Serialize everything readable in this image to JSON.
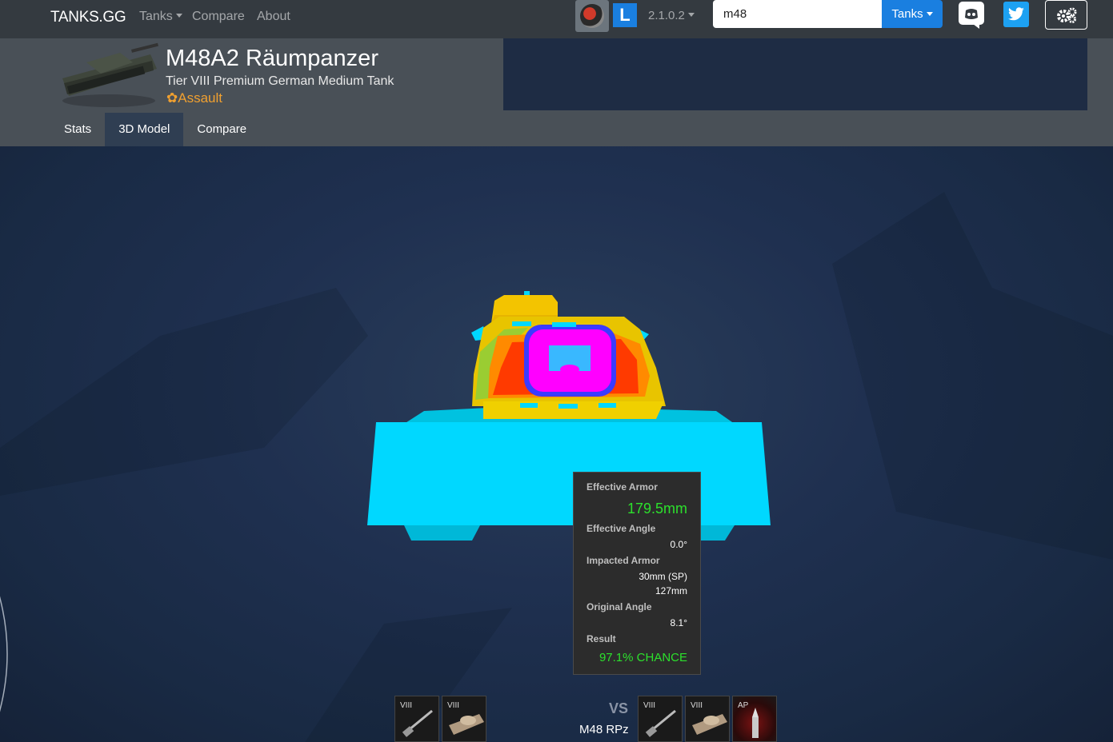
{
  "navbar": {
    "brand": "TANKS.GG",
    "links": [
      "Tanks",
      "Compare",
      "About"
    ],
    "version": "2.1.0.2",
    "l_badge": "L",
    "search_value": "m48",
    "tanks_button": "Tanks",
    "icons": [
      "wot-logo-icon",
      "discord-icon",
      "twitter-icon",
      "settings-icon"
    ]
  },
  "header": {
    "tank_name": "M48A2 Räumpanzer",
    "subtitle": "Tier VIII Premium German Medium Tank",
    "role_icon": "✿",
    "role": "Assault",
    "tabs": [
      "Stats",
      "3D Model",
      "Compare"
    ],
    "active_tab": "3D Model"
  },
  "tooltip": {
    "effective_armor_label": "Effective Armor",
    "effective_armor": "179.5mm",
    "effective_angle_label": "Effective Angle",
    "effective_angle": "0.0°",
    "impacted_armor_label": "Impacted Armor",
    "impacted_armor_1": "30mm (SP)",
    "impacted_armor_2": "127mm",
    "original_angle_label": "Original Angle",
    "original_angle": "8.1°",
    "result_label": "Result",
    "result": "97.1% CHANCE"
  },
  "bottom": {
    "left_slots": [
      {
        "tier": "VIII",
        "kind": "gun"
      },
      {
        "tier": "VIII",
        "kind": "tank"
      }
    ],
    "vs_label": "VS",
    "vs_name": "M48 RPz",
    "right_slots": [
      {
        "tier": "VIII",
        "kind": "gun"
      },
      {
        "tier": "VIII",
        "kind": "tank"
      },
      {
        "tier": "AP",
        "kind": "shell"
      }
    ]
  },
  "colors": {
    "navbar": "#343a40",
    "header": "#495057",
    "accent_blue": "#1a7fe0",
    "role_orange": "#f0a030",
    "armor_green": "#2ce02c",
    "armor_cyan": "#00d8ff",
    "armor_magenta": "#ff00ff"
  }
}
